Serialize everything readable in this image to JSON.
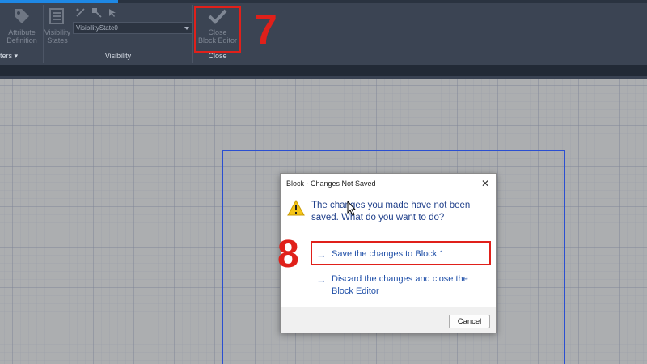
{
  "ribbon": {
    "attribute_definition": "Attribute\nDefinition",
    "visibility_states": "Visibility\nStates",
    "visibility_state_value": "VisibilityState0",
    "visibility_panel": "Visibility",
    "parameters_panel": "ters",
    "close_block_editor": "Close\nBlock Editor",
    "close_panel": "Close"
  },
  "annotations": {
    "step7": "7",
    "step8": "8",
    "highlight_color": "#e0201a"
  },
  "dialog": {
    "title": "Block - Changes Not Saved",
    "close_glyph": "✕",
    "message": "The changes you made have not been saved. What do you want to do?",
    "options": [
      {
        "arrow": "→",
        "label": "Save the changes to Block 1"
      },
      {
        "arrow": "→",
        "label": "Discard the changes and close the Block Editor"
      }
    ],
    "cancel_label": "Cancel",
    "icon": "warning-icon"
  },
  "colors": {
    "ribbon": "#3b4453",
    "canvas": "#acaeb0",
    "block_frame": "#2b4fd1",
    "link": "#1f4fa8"
  }
}
